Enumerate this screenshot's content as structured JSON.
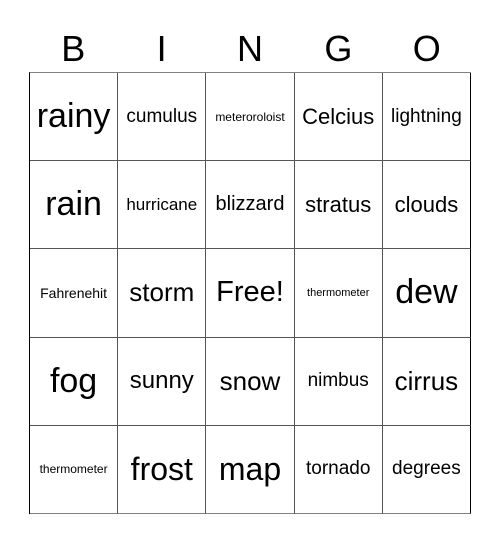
{
  "header": {
    "letters": [
      "B",
      "I",
      "N",
      "G",
      "O"
    ]
  },
  "board": {
    "rows": [
      [
        "rainy",
        "cumulus",
        "meteroroloist",
        "Celcius",
        "lightning"
      ],
      [
        "rain",
        "hurricane",
        "blizzard",
        "stratus",
        "clouds"
      ],
      [
        "Fahrenehit",
        "storm",
        "Free!",
        "thermometer",
        "dew"
      ],
      [
        "fog",
        "sunny",
        "snow",
        "nimbus",
        "cirrus"
      ],
      [
        "thermometer",
        "frost",
        "map",
        "tornado",
        "degrees"
      ]
    ],
    "free_space": "Free!"
  }
}
